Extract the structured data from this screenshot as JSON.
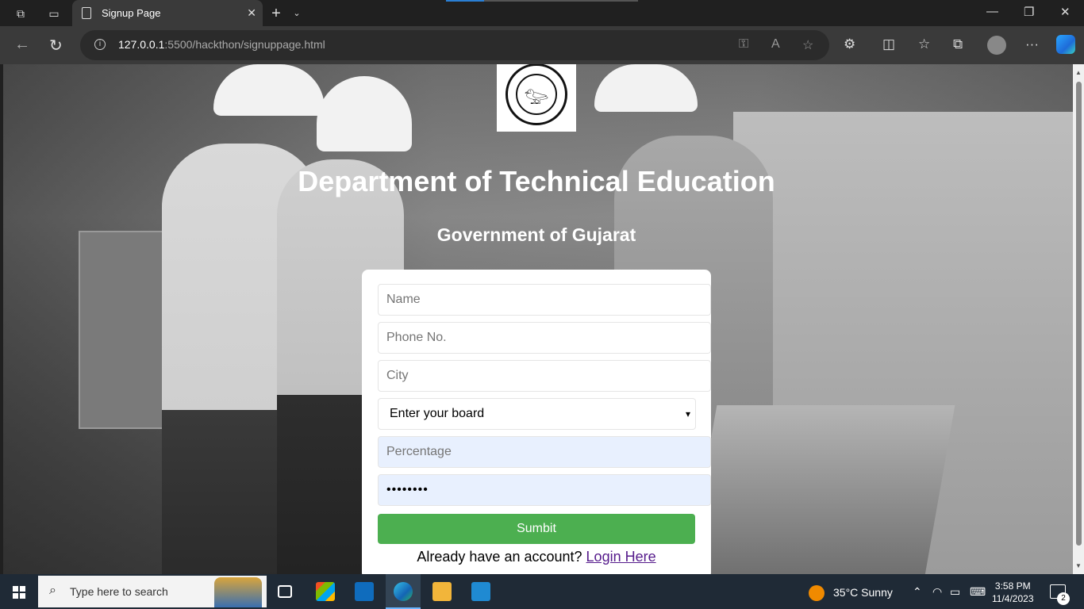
{
  "browser": {
    "tab_title": "Signup Page",
    "url_host": "127.0.0.1",
    "url_rest": ":5500/hackthon/signuppage.html"
  },
  "page": {
    "title": "Department of Technical Education",
    "subtitle": "Government of Gujarat"
  },
  "form": {
    "name_placeholder": "Name",
    "phone_placeholder": "Phone No.",
    "city_placeholder": "City",
    "board_selected": "Enter your board",
    "percentage_placeholder": "Percentage",
    "password_value": "••••••••",
    "submit_label": "Sumbit",
    "login_prompt": "Already have an account?",
    "login_link": "Login Here"
  },
  "taskbar": {
    "search_placeholder": "Type here to search",
    "weather": "35°C  Sunny",
    "time": "3:58 PM",
    "date": "11/4/2023",
    "notification_count": "2"
  },
  "colors": {
    "submit": "#4caf50",
    "autofill": "#e8f0fe",
    "link": "#551a8b"
  }
}
